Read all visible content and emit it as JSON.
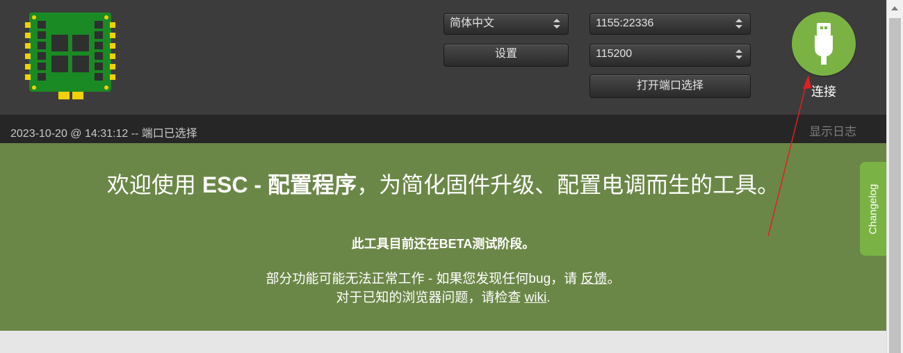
{
  "header": {
    "language_select": {
      "value": "简体中文"
    },
    "settings_label": "设置",
    "port_select": {
      "value": "1155:22336"
    },
    "baud_select": {
      "value": "115200"
    },
    "open_port_label": "打开端口选择",
    "connect_label": "连接",
    "icons": {
      "logo": "esc-board-logo",
      "connect": "usb-icon"
    },
    "colors": {
      "background": "#3c3c3c",
      "connect_button": "#7ab344"
    }
  },
  "status_bar": {
    "text": "2023-10-20 @ 14:31:12 -- 端口已选择",
    "show_log_label": "显示日志"
  },
  "welcome": {
    "title_prefix": "欢迎使用 ",
    "title_bold": "ESC - 配置程序",
    "title_suffix": "，为简化固件升级、配置电调而生的工具。",
    "beta_notice": "此工具目前还在BETA测试阶段。",
    "line1_text": "部分功能可能无法正常工作 - 如果您发现任何bug，请 ",
    "line1_link": "反馈",
    "line1_end": "。",
    "line2_text": "对于已知的浏览器问题，请检查 ",
    "line2_link": "wiki",
    "line2_end": ".",
    "colors": {
      "background": "#6b8747"
    }
  },
  "changelog_tab": {
    "label": "Changelog",
    "color": "#7ab344"
  },
  "annotation": {
    "color": "#e02020"
  }
}
